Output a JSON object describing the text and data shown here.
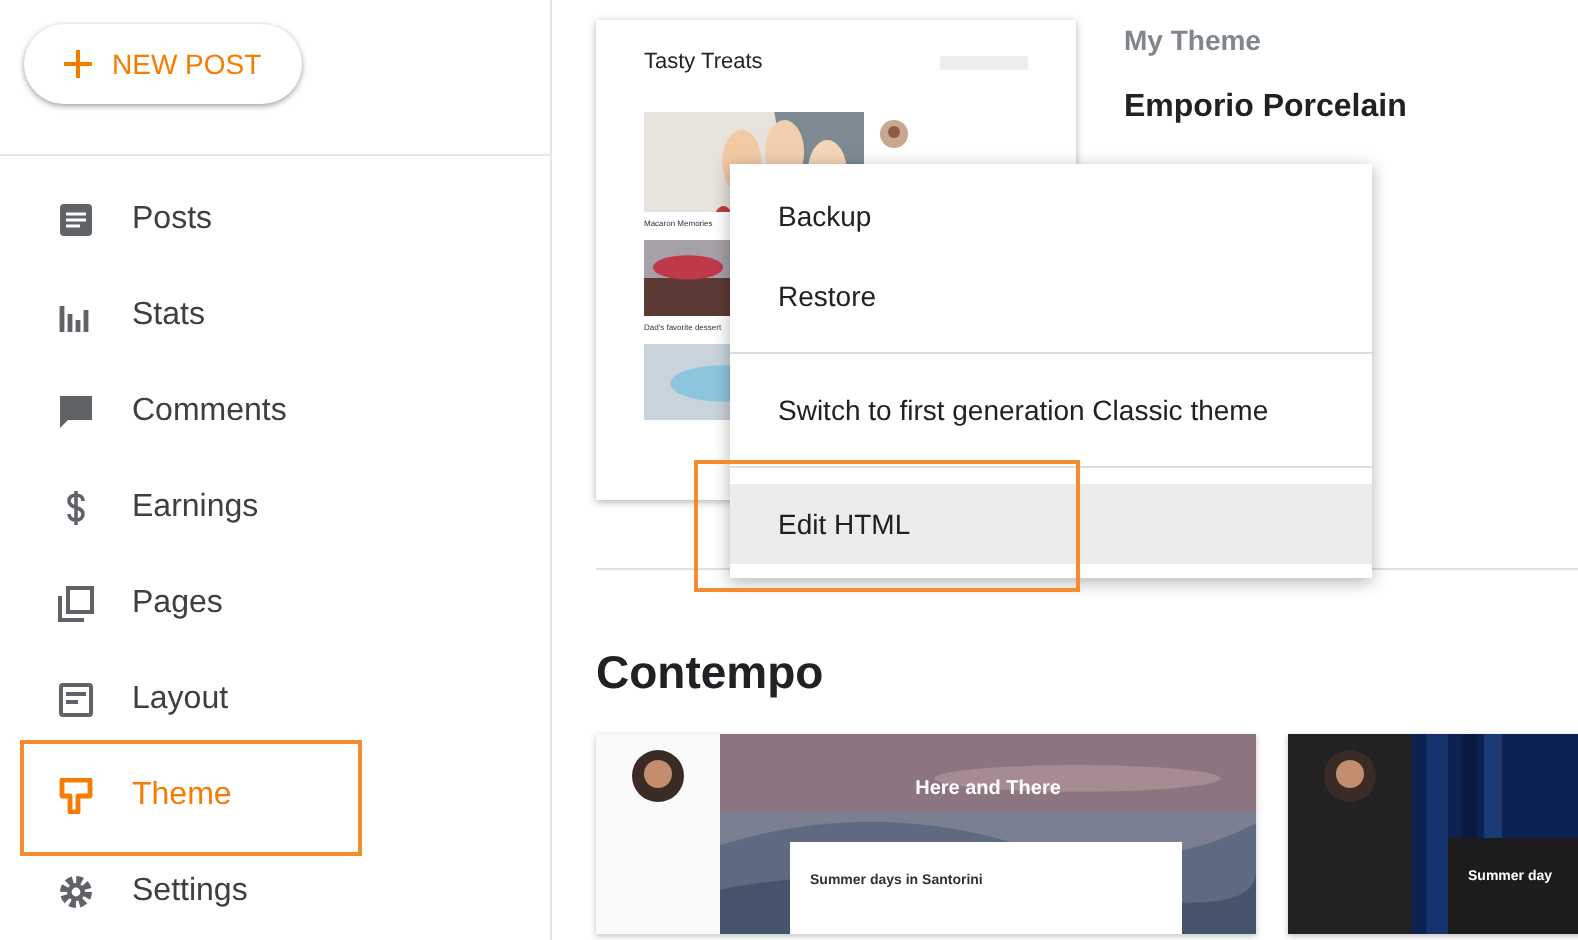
{
  "new_post_button": {
    "label": "NEW POST"
  },
  "sidebar": {
    "items": [
      {
        "kind": "posts",
        "label": "Posts",
        "selected": false,
        "highlighted": false
      },
      {
        "kind": "stats",
        "label": "Stats",
        "selected": false,
        "highlighted": false
      },
      {
        "kind": "comments",
        "label": "Comments",
        "selected": false,
        "highlighted": false
      },
      {
        "kind": "earnings",
        "label": "Earnings",
        "selected": false,
        "highlighted": false
      },
      {
        "kind": "pages",
        "label": "Pages",
        "selected": false,
        "highlighted": false
      },
      {
        "kind": "layout",
        "label": "Layout",
        "selected": false,
        "highlighted": false
      },
      {
        "kind": "theme",
        "label": "Theme",
        "selected": true,
        "highlighted": true
      },
      {
        "kind": "settings",
        "label": "Settings",
        "selected": false,
        "highlighted": false
      }
    ]
  },
  "current_theme": {
    "heading": "My Theme",
    "name": "Emporio Porcelain",
    "preview": {
      "blog_title": "Tasty Treats",
      "post_titles": [
        "Macaron Memories",
        "Dad's favorite dessert"
      ]
    }
  },
  "menu": {
    "groups": [
      [
        {
          "label": "Backup",
          "selected": false,
          "highlighted": false
        },
        {
          "label": "Restore",
          "selected": false,
          "highlighted": false
        }
      ],
      [
        {
          "label": "Switch to first generation Classic theme",
          "selected": false,
          "highlighted": false
        }
      ],
      [
        {
          "label": "Edit HTML",
          "selected": true,
          "highlighted": true
        }
      ]
    ]
  },
  "gallery": {
    "title": "Contempo",
    "themes": [
      {
        "kind": "light",
        "blog_title": "Here and There",
        "post_title": "Summer days in Santorini"
      },
      {
        "kind": "dark",
        "post_title": "Summer day"
      }
    ]
  }
}
